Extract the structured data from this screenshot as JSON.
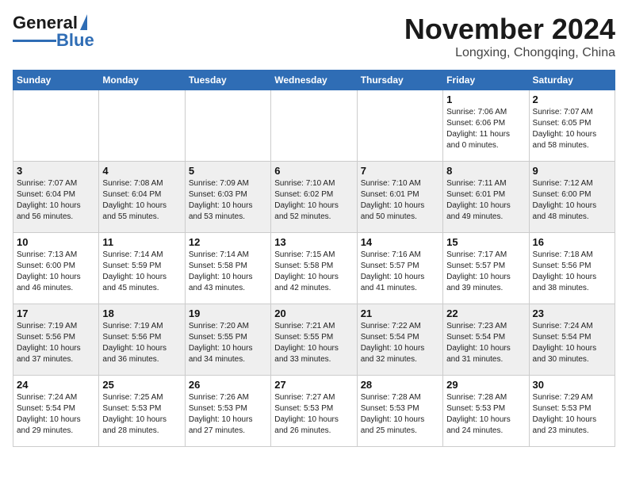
{
  "header": {
    "logo_line1": "General",
    "logo_line2": "Blue",
    "month": "November 2024",
    "location": "Longxing, Chongqing, China"
  },
  "weekdays": [
    "Sunday",
    "Monday",
    "Tuesday",
    "Wednesday",
    "Thursday",
    "Friday",
    "Saturday"
  ],
  "rows": [
    {
      "shade": "light",
      "cells": [
        {
          "day": "",
          "info": ""
        },
        {
          "day": "",
          "info": ""
        },
        {
          "day": "",
          "info": ""
        },
        {
          "day": "",
          "info": ""
        },
        {
          "day": "",
          "info": ""
        },
        {
          "day": "1",
          "info": "Sunrise: 7:06 AM\nSunset: 6:06 PM\nDaylight: 11 hours\nand 0 minutes."
        },
        {
          "day": "2",
          "info": "Sunrise: 7:07 AM\nSunset: 6:05 PM\nDaylight: 10 hours\nand 58 minutes."
        }
      ]
    },
    {
      "shade": "dark",
      "cells": [
        {
          "day": "3",
          "info": "Sunrise: 7:07 AM\nSunset: 6:04 PM\nDaylight: 10 hours\nand 56 minutes."
        },
        {
          "day": "4",
          "info": "Sunrise: 7:08 AM\nSunset: 6:04 PM\nDaylight: 10 hours\nand 55 minutes."
        },
        {
          "day": "5",
          "info": "Sunrise: 7:09 AM\nSunset: 6:03 PM\nDaylight: 10 hours\nand 53 minutes."
        },
        {
          "day": "6",
          "info": "Sunrise: 7:10 AM\nSunset: 6:02 PM\nDaylight: 10 hours\nand 52 minutes."
        },
        {
          "day": "7",
          "info": "Sunrise: 7:10 AM\nSunset: 6:01 PM\nDaylight: 10 hours\nand 50 minutes."
        },
        {
          "day": "8",
          "info": "Sunrise: 7:11 AM\nSunset: 6:01 PM\nDaylight: 10 hours\nand 49 minutes."
        },
        {
          "day": "9",
          "info": "Sunrise: 7:12 AM\nSunset: 6:00 PM\nDaylight: 10 hours\nand 48 minutes."
        }
      ]
    },
    {
      "shade": "light",
      "cells": [
        {
          "day": "10",
          "info": "Sunrise: 7:13 AM\nSunset: 6:00 PM\nDaylight: 10 hours\nand 46 minutes."
        },
        {
          "day": "11",
          "info": "Sunrise: 7:14 AM\nSunset: 5:59 PM\nDaylight: 10 hours\nand 45 minutes."
        },
        {
          "day": "12",
          "info": "Sunrise: 7:14 AM\nSunset: 5:58 PM\nDaylight: 10 hours\nand 43 minutes."
        },
        {
          "day": "13",
          "info": "Sunrise: 7:15 AM\nSunset: 5:58 PM\nDaylight: 10 hours\nand 42 minutes."
        },
        {
          "day": "14",
          "info": "Sunrise: 7:16 AM\nSunset: 5:57 PM\nDaylight: 10 hours\nand 41 minutes."
        },
        {
          "day": "15",
          "info": "Sunrise: 7:17 AM\nSunset: 5:57 PM\nDaylight: 10 hours\nand 39 minutes."
        },
        {
          "day": "16",
          "info": "Sunrise: 7:18 AM\nSunset: 5:56 PM\nDaylight: 10 hours\nand 38 minutes."
        }
      ]
    },
    {
      "shade": "dark",
      "cells": [
        {
          "day": "17",
          "info": "Sunrise: 7:19 AM\nSunset: 5:56 PM\nDaylight: 10 hours\nand 37 minutes."
        },
        {
          "day": "18",
          "info": "Sunrise: 7:19 AM\nSunset: 5:56 PM\nDaylight: 10 hours\nand 36 minutes."
        },
        {
          "day": "19",
          "info": "Sunrise: 7:20 AM\nSunset: 5:55 PM\nDaylight: 10 hours\nand 34 minutes."
        },
        {
          "day": "20",
          "info": "Sunrise: 7:21 AM\nSunset: 5:55 PM\nDaylight: 10 hours\nand 33 minutes."
        },
        {
          "day": "21",
          "info": "Sunrise: 7:22 AM\nSunset: 5:54 PM\nDaylight: 10 hours\nand 32 minutes."
        },
        {
          "day": "22",
          "info": "Sunrise: 7:23 AM\nSunset: 5:54 PM\nDaylight: 10 hours\nand 31 minutes."
        },
        {
          "day": "23",
          "info": "Sunrise: 7:24 AM\nSunset: 5:54 PM\nDaylight: 10 hours\nand 30 minutes."
        }
      ]
    },
    {
      "shade": "light",
      "cells": [
        {
          "day": "24",
          "info": "Sunrise: 7:24 AM\nSunset: 5:54 PM\nDaylight: 10 hours\nand 29 minutes."
        },
        {
          "day": "25",
          "info": "Sunrise: 7:25 AM\nSunset: 5:53 PM\nDaylight: 10 hours\nand 28 minutes."
        },
        {
          "day": "26",
          "info": "Sunrise: 7:26 AM\nSunset: 5:53 PM\nDaylight: 10 hours\nand 27 minutes."
        },
        {
          "day": "27",
          "info": "Sunrise: 7:27 AM\nSunset: 5:53 PM\nDaylight: 10 hours\nand 26 minutes."
        },
        {
          "day": "28",
          "info": "Sunrise: 7:28 AM\nSunset: 5:53 PM\nDaylight: 10 hours\nand 25 minutes."
        },
        {
          "day": "29",
          "info": "Sunrise: 7:28 AM\nSunset: 5:53 PM\nDaylight: 10 hours\nand 24 minutes."
        },
        {
          "day": "30",
          "info": "Sunrise: 7:29 AM\nSunset: 5:53 PM\nDaylight: 10 hours\nand 23 minutes."
        }
      ]
    }
  ]
}
